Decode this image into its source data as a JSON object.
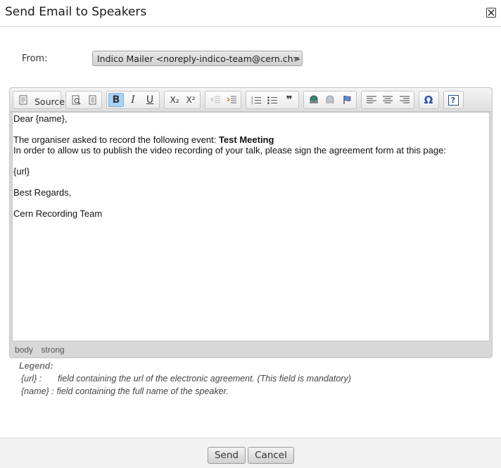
{
  "dialog": {
    "title": "Send Email to Speakers",
    "close_glyph": "✕"
  },
  "from": {
    "label": "From:",
    "selected": "Indico Mailer <noreply-indico-team@cern.ch>"
  },
  "toolbar": {
    "source_label": "Source",
    "bold": "B",
    "italic": "I",
    "underline": "U",
    "subscript": "X₂",
    "superscript": "X²",
    "blockquote": "❞",
    "special_char": "Ω",
    "help": "?"
  },
  "body": {
    "greeting": "Dear {name},",
    "line1_prefix": "The organiser asked to record the following event: ",
    "line1_event": "Test Meeting",
    "line2": "In order to allow us to publish the video recording of your talk, please sign the agreement form at this page:",
    "url": "{url}",
    "regards": "Best Regards,",
    "signature": "Cern Recording Team"
  },
  "pathbar": [
    "body",
    "strong"
  ],
  "legend": {
    "title": "Legend:",
    "items": [
      {
        "key": "{url} :",
        "desc": "field containing the url of the electronic agreement. (This field is mandatory)"
      },
      {
        "key": "{name} :",
        "desc": "field containing the full name of the speaker."
      }
    ]
  },
  "buttons": {
    "send": "Send",
    "cancel": "Cancel"
  },
  "colors": {
    "active_button": "#a9d3f5",
    "toolbar_bg": "#e6e6e6"
  }
}
